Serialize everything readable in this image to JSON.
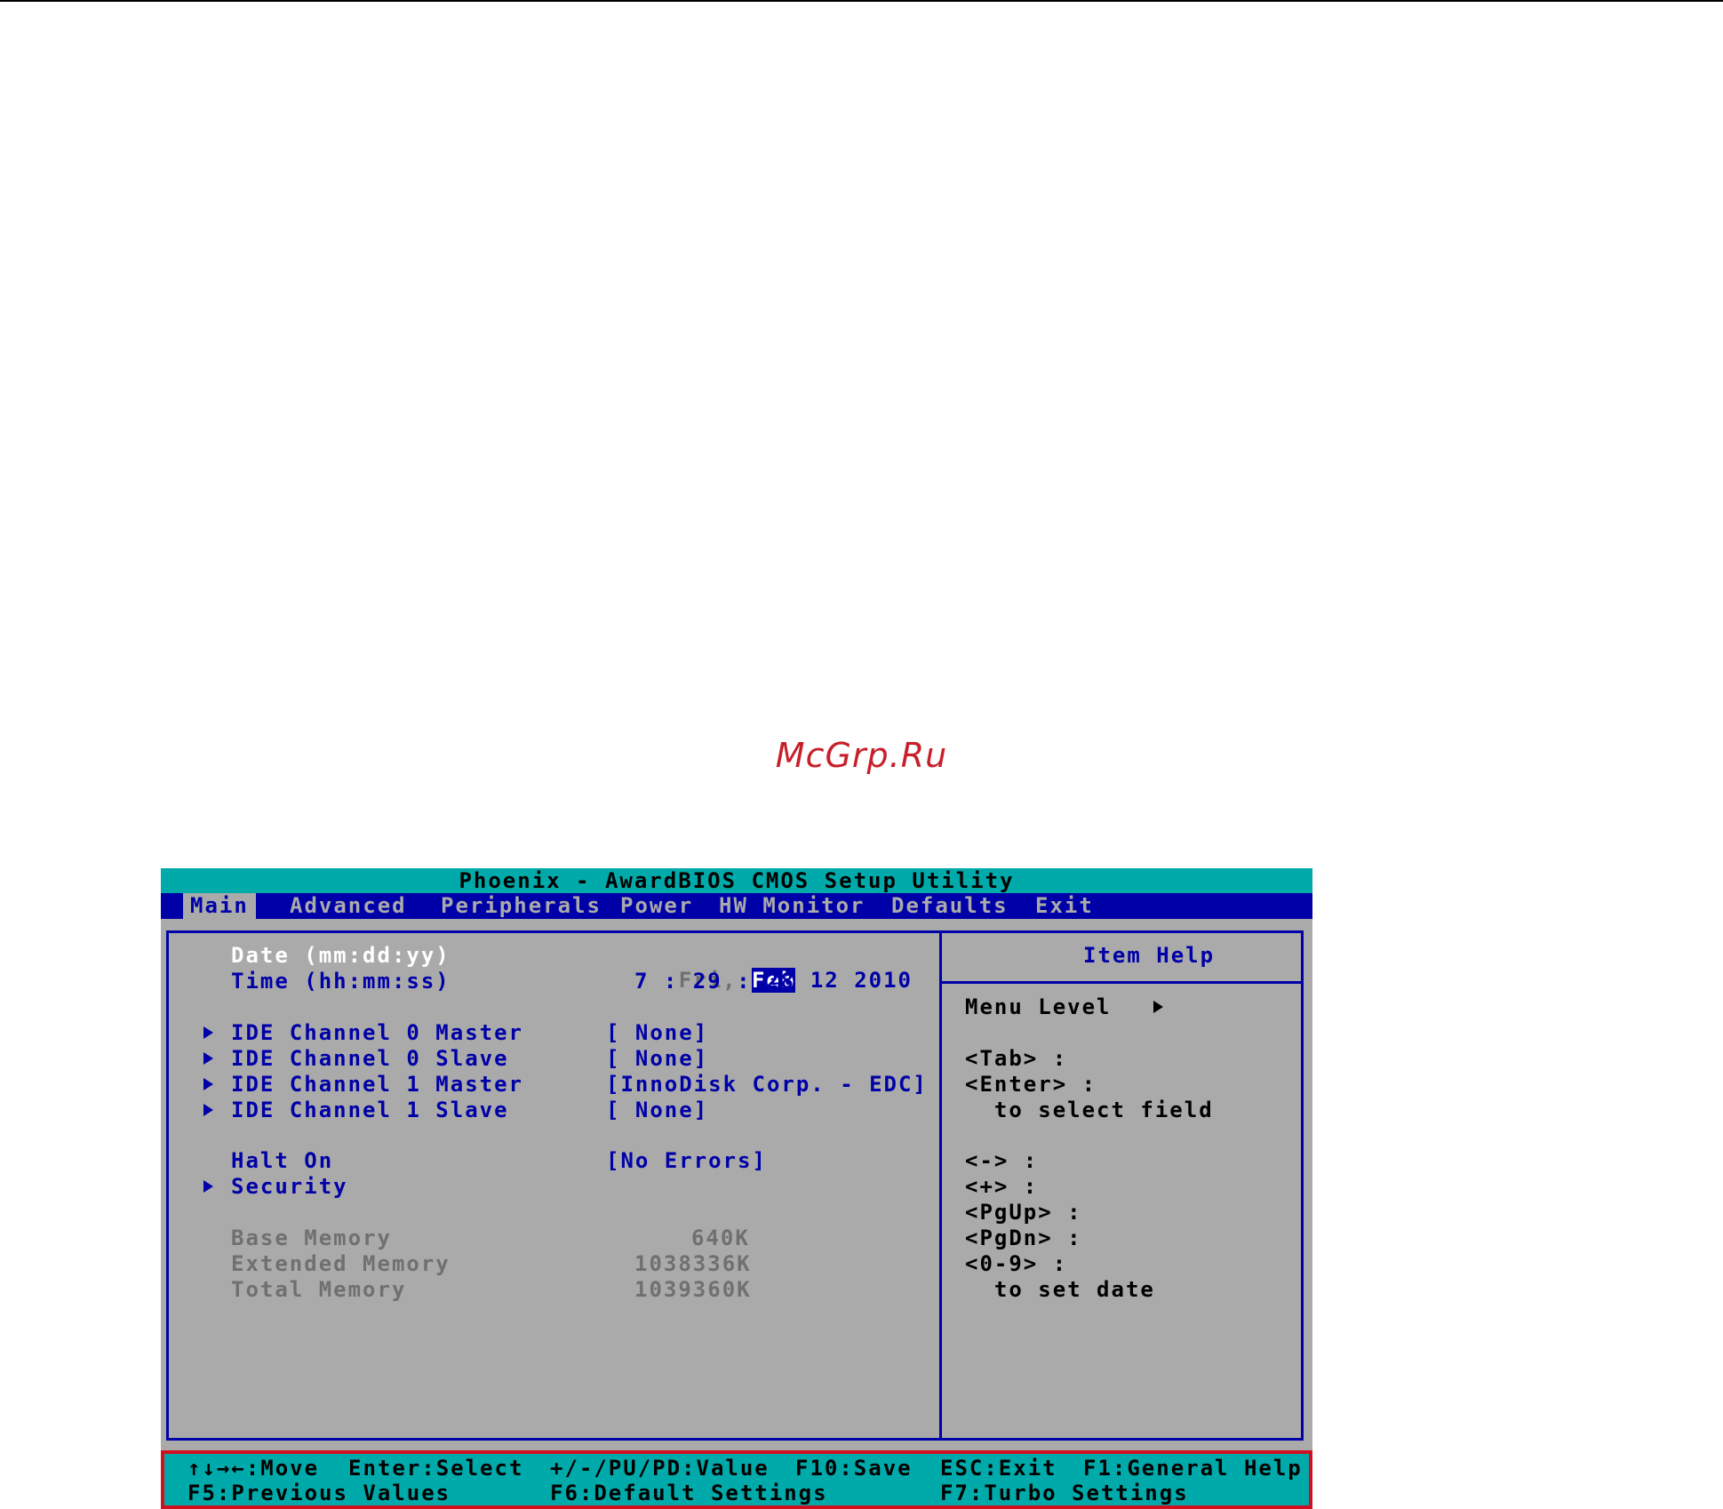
{
  "watermark": "McGrp.Ru",
  "bios": {
    "title": "Phoenix - AwardBIOS CMOS Setup Utility",
    "tabs": [
      {
        "label": "Main",
        "active": true
      },
      {
        "label": "Advanced",
        "active": false
      },
      {
        "label": "Peripherals",
        "active": false
      },
      {
        "label": "Power",
        "active": false
      },
      {
        "label": "HW Monitor",
        "active": false
      },
      {
        "label": "Defaults",
        "active": false
      },
      {
        "label": "Exit",
        "active": false
      }
    ],
    "main": {
      "date": {
        "label": "Date (mm:dd:yy)",
        "day": "Fri,",
        "month": "Feb",
        "rest": "12 2010"
      },
      "time": {
        "label": "Time (hh:mm:ss)",
        "value": "7 : 29 : 28"
      },
      "ide": [
        {
          "label": "IDE Channel 0 Master",
          "value": "[ None]"
        },
        {
          "label": "IDE Channel 0 Slave",
          "value": "[ None]"
        },
        {
          "label": "IDE Channel 1 Master",
          "value": "[InnoDisk Corp. - EDC]"
        },
        {
          "label": "IDE Channel 1 Slave",
          "value": "[ None]"
        }
      ],
      "halt_on": {
        "label": "Halt On",
        "value": "[No Errors]"
      },
      "security": {
        "label": "Security"
      },
      "memory": [
        {
          "label": "Base Memory",
          "value": "640K"
        },
        {
          "label": "Extended Memory",
          "value": "1038336K"
        },
        {
          "label": "Total Memory",
          "value": "1039360K"
        }
      ]
    },
    "help": {
      "title": "Item Help",
      "menu_level": "Menu Level",
      "lines": [
        "<Tab> :",
        "<Enter> :",
        "  to select field",
        "<-> :",
        "<+> :",
        "<PgUp> :",
        "<PgDn> :",
        "<0-9> :",
        "  to set date"
      ]
    },
    "footer": {
      "row1": [
        "↑↓→←:Move",
        "Enter:Select",
        "+/-/PU/PD:Value",
        "F10:Save",
        "ESC:Exit",
        "F1:General Help"
      ],
      "row2": [
        "F5:Previous Values",
        "F6:Default Settings",
        "F7:Turbo Settings"
      ]
    },
    "colors": {
      "background": "#aaaaaa",
      "title_bar": "#00aaaa",
      "menu_bar": "#0000a8",
      "text": "#0000a8",
      "highlight_border": "#d01020"
    }
  }
}
